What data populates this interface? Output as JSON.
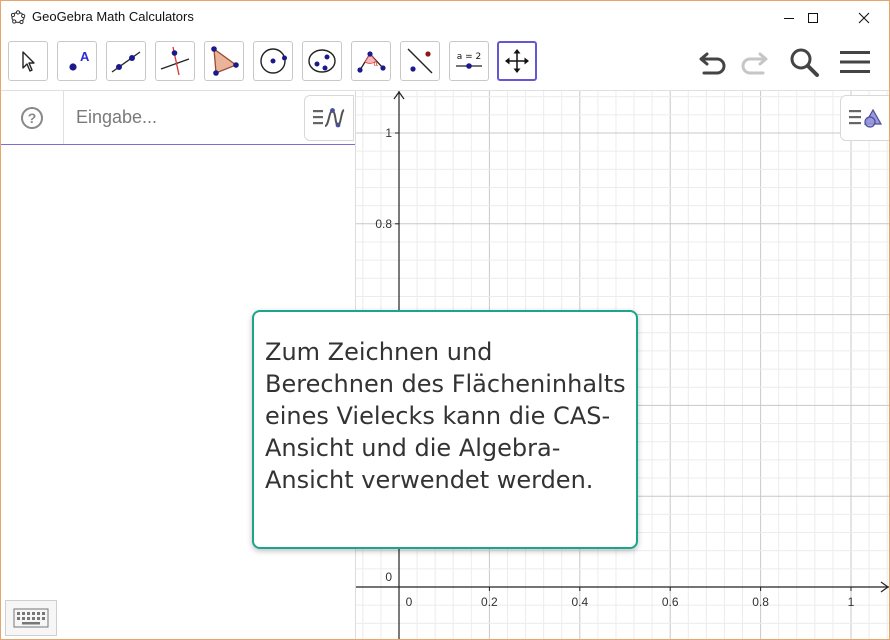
{
  "window": {
    "title": "GeoGebra Math Calculators",
    "minimize_icon": "minimize-icon",
    "maximize_icon": "maximize-icon",
    "close_icon": "close-icon"
  },
  "toolbar": {
    "tools": [
      {
        "name": "move-tool",
        "icon": "arrow-pointer-icon"
      },
      {
        "name": "point-tool",
        "icon": "point-icon",
        "text": "A"
      },
      {
        "name": "line-tool",
        "icon": "line-icon"
      },
      {
        "name": "perpendicular-line-tool",
        "icon": "perpendicular-icon"
      },
      {
        "name": "polygon-tool",
        "icon": "polygon-icon"
      },
      {
        "name": "circle-tool",
        "icon": "circle-icon"
      },
      {
        "name": "conic-tool",
        "icon": "ellipse-icon"
      },
      {
        "name": "angle-tool",
        "icon": "angle-icon",
        "text": "α"
      },
      {
        "name": "reflect-tool",
        "icon": "reflect-icon"
      },
      {
        "name": "slider-tool",
        "icon": "slider-icon",
        "text": "a = 2"
      },
      {
        "name": "move-graphics-view-tool",
        "icon": "move-view-icon",
        "active": true
      }
    ],
    "right": [
      "undo-icon",
      "redo-icon",
      "search-icon",
      "menu-icon"
    ]
  },
  "algebra": {
    "help_icon": "help-icon",
    "input_placeholder": "Eingabe...",
    "input_value": "",
    "style_icon": "algebra-style-icon",
    "keyboard_icon": "keyboard-icon"
  },
  "graphics": {
    "style_icon": "graphics-style-icon",
    "x_ticks": [
      "0",
      "0.2",
      "0.4",
      "0.6",
      "0.8",
      "1"
    ],
    "y_ticks": [
      "1",
      "0.8",
      "0"
    ],
    "xlim": [
      -0.02,
      1.07
    ],
    "ylim": [
      -0.1,
      1.2
    ]
  },
  "bubble": {
    "text": "Zum Zeichnen und Berechnen des Flächeninhalts eines Vielecks kann die CAS-Ansicht und die Algebra-Ansicht verwendet werden."
  },
  "colors": {
    "active_tool_border": "#6557d2",
    "bubble_border": "#1ba58c",
    "window_border": "#e8a46a",
    "tool_point_blue": "#1a1a8c"
  }
}
